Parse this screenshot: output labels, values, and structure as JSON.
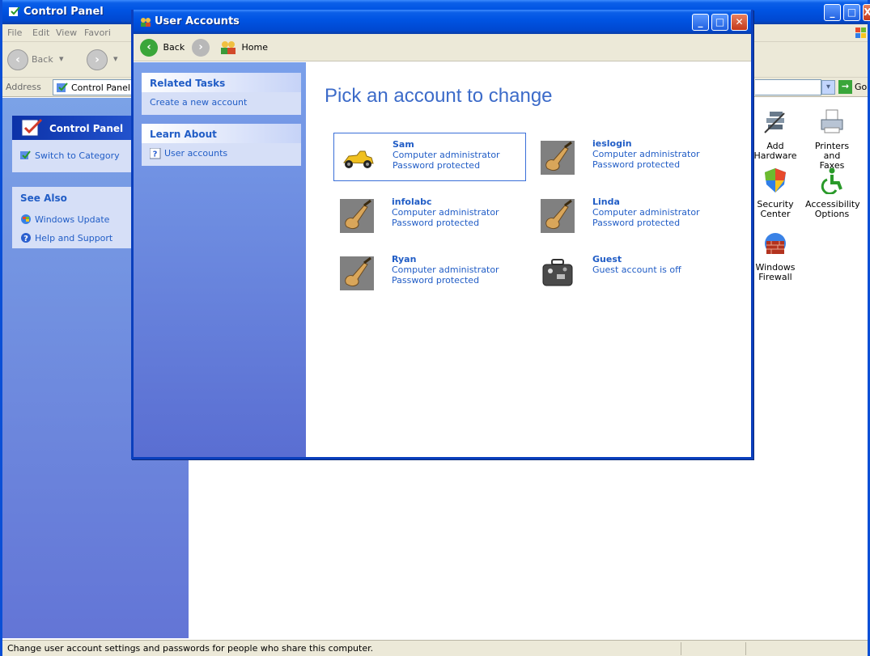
{
  "cp": {
    "title": "Control Panel",
    "menu": [
      "File",
      "Edit",
      "View",
      "Favori"
    ],
    "toolbar": {
      "back": "Back"
    },
    "address": {
      "label": "Address",
      "value": "Control Panel",
      "go": "Go"
    },
    "sidebar": {
      "panel_title": "Control Panel",
      "switch_link": "Switch to Category",
      "see_also": "See Also",
      "see_also_items": [
        "Windows Update",
        "Help and Support"
      ]
    },
    "icons": [
      {
        "label1": "Add",
        "label2": "Hardware",
        "icon": "add-hardware-icon"
      },
      {
        "label1": "Printers and",
        "label2": "Faxes",
        "icon": "printer-icon"
      },
      {
        "label1": "Security",
        "label2": "Center",
        "icon": "security-shield-icon"
      },
      {
        "label1": "Accessibility",
        "label2": "Options",
        "icon": "accessibility-icon"
      },
      {
        "label1": "Windows",
        "label2": "Firewall",
        "icon": "firewall-icon"
      }
    ],
    "status": "Change user account settings and passwords for people who share this computer."
  },
  "ua": {
    "title": "User Accounts",
    "toolbar": {
      "back": "Back",
      "home": "Home"
    },
    "related_tasks": {
      "title": "Related Tasks",
      "items": [
        "Create a new account"
      ]
    },
    "learn_about": {
      "title": "Learn About",
      "items": [
        "User accounts"
      ]
    },
    "heading": "Pick an account to change",
    "accounts": [
      {
        "name": "Sam",
        "line1": "Computer administrator",
        "line2": "Password protected",
        "picture": "race-car-icon"
      },
      {
        "name": "ieslogin",
        "line1": "Computer administrator",
        "line2": "Password protected",
        "picture": "guitar-icon"
      },
      {
        "name": "infolabc",
        "line1": "Computer administrator",
        "line2": "Password protected",
        "picture": "guitar-icon"
      },
      {
        "name": "Linda",
        "line1": "Computer administrator",
        "line2": "Password protected",
        "picture": "guitar-icon"
      },
      {
        "name": "Ryan",
        "line1": "Computer administrator",
        "line2": "Password protected",
        "picture": "guitar-icon"
      },
      {
        "name": "Guest",
        "line1": "Guest account is off",
        "line2": "",
        "picture": "suitcase-icon"
      }
    ]
  },
  "colors": {
    "xp_blue": "#0054e3",
    "link_blue": "#215dc6",
    "heading_blue": "#3c6bc9",
    "chrome": "#ece9d8"
  }
}
